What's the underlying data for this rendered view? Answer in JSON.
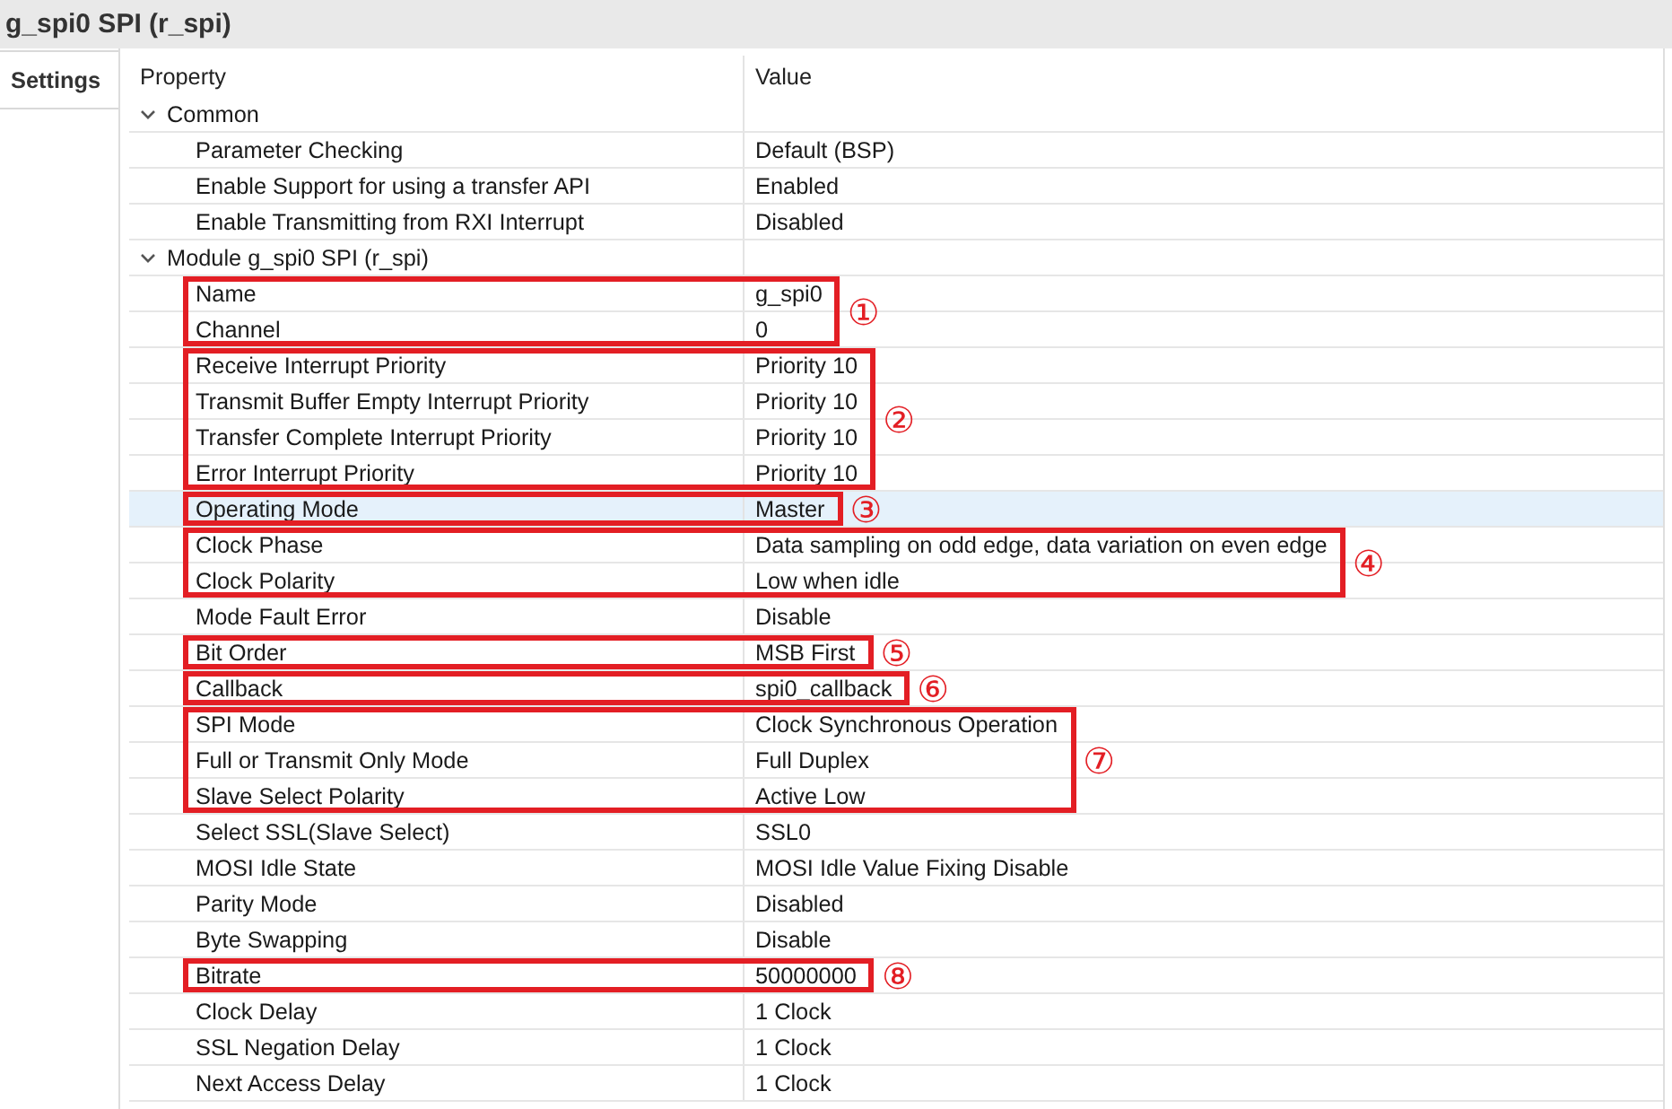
{
  "title": "g_spi0 SPI (r_spi)",
  "tabs": [
    {
      "label": "Settings",
      "selected": true
    }
  ],
  "table": {
    "columns": [
      "Property",
      "Value"
    ],
    "groups": [
      {
        "label": "Common",
        "expanded": true,
        "selected": false,
        "items": [
          {
            "kind": "row",
            "property": "Parameter Checking",
            "value": "Default (BSP)",
            "selected": false
          },
          {
            "kind": "row",
            "property": "Enable Support for using a transfer API",
            "value": "Enabled",
            "selected": false
          },
          {
            "kind": "row",
            "property": "Enable Transmitting from RXI Interrupt",
            "value": "Disabled",
            "selected": false
          }
        ]
      },
      {
        "label": "Module g_spi0 SPI (r_spi)",
        "expanded": true,
        "selected": false,
        "items": [
          {
            "kind": "callout",
            "label": "①",
            "rows": [
              {
                "property": "Name",
                "value": "g_spi0",
                "selected": false
              },
              {
                "property": "Channel",
                "value": "0",
                "selected": false
              }
            ]
          },
          {
            "kind": "callout",
            "label": "②",
            "rows": [
              {
                "property": "Receive Interrupt Priority",
                "value": "Priority 10",
                "selected": false
              },
              {
                "property": "Transmit Buffer Empty Interrupt Priority",
                "value": "Priority 10",
                "selected": false
              },
              {
                "property": "Transfer Complete Interrupt Priority",
                "value": "Priority 10",
                "selected": false
              },
              {
                "property": "Error Interrupt Priority",
                "value": "Priority 10",
                "selected": false
              }
            ]
          },
          {
            "kind": "callout",
            "label": "③",
            "rows": [
              {
                "property": "Operating Mode",
                "value": "Master",
                "selected": true
              }
            ]
          },
          {
            "kind": "callout",
            "label": "④",
            "rows": [
              {
                "property": "Clock Phase",
                "value": "Data sampling on odd edge, data variation on even edge",
                "selected": false
              },
              {
                "property": "Clock Polarity",
                "value": "Low when idle",
                "selected": false
              }
            ]
          },
          {
            "kind": "row",
            "property": "Mode Fault Error",
            "value": "Disable",
            "selected": false
          },
          {
            "kind": "callout",
            "label": "⑤",
            "rows": [
              {
                "property": "Bit Order",
                "value": "MSB First",
                "selected": false
              }
            ]
          },
          {
            "kind": "callout",
            "label": "⑥",
            "rows": [
              {
                "property": "Callback",
                "value": "spi0_callback",
                "selected": false
              }
            ]
          },
          {
            "kind": "callout",
            "label": "⑦",
            "rows": [
              {
                "property": "SPI Mode",
                "value": "Clock Synchronous Operation",
                "selected": false
              },
              {
                "property": "Full or Transmit Only Mode",
                "value": "Full Duplex",
                "selected": false
              },
              {
                "property": "Slave Select Polarity",
                "value": "Active Low",
                "selected": false
              }
            ]
          },
          {
            "kind": "row",
            "property": "Select SSL(Slave Select)",
            "value": "SSL0",
            "selected": false
          },
          {
            "kind": "row",
            "property": "MOSI Idle State",
            "value": "MOSI Idle Value Fixing Disable",
            "selected": false
          },
          {
            "kind": "row",
            "property": "Parity Mode",
            "value": "Disabled",
            "selected": false
          },
          {
            "kind": "row",
            "property": "Byte Swapping",
            "value": "Disable",
            "selected": false
          },
          {
            "kind": "callout",
            "label": "⑧",
            "rows": [
              {
                "property": "Bitrate",
                "value": "50000000",
                "selected": false
              }
            ]
          },
          {
            "kind": "row",
            "property": "Clock Delay",
            "value": "1 Clock",
            "selected": false
          },
          {
            "kind": "row",
            "property": "SSL Negation Delay",
            "value": "1 Clock",
            "selected": false
          },
          {
            "kind": "row",
            "property": "Next Access Delay",
            "value": "1 Clock",
            "selected": false
          }
        ]
      }
    ]
  }
}
